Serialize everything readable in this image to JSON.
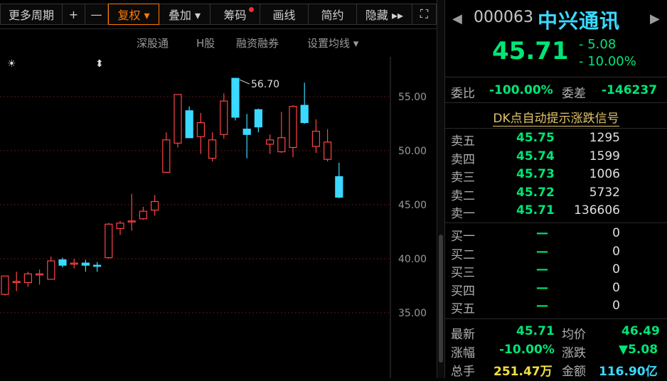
{
  "toolbar": {
    "items": [
      {
        "label": "更多周期",
        "w": 88
      },
      {
        "label": "+",
        "w": 32
      },
      {
        "label": "—",
        "w": 32
      },
      {
        "label": "复权 ▾",
        "w": 72,
        "active": true
      },
      {
        "label": "叠加 ▾",
        "w": 72
      },
      {
        "label": "筹码",
        "w": 70,
        "dot": true
      },
      {
        "label": "画线",
        "w": 68
      },
      {
        "label": "简约",
        "w": 68
      },
      {
        "label": "隐藏 ▸▸",
        "w": 78
      },
      {
        "label": "⛶",
        "w": 34
      }
    ]
  },
  "subbar": {
    "links": [
      "深股通",
      "H股",
      "融资融券",
      "设置均线 ▾"
    ]
  },
  "chart": {
    "markers": [
      "☀",
      "⬍"
    ],
    "y_labels": [
      "55.00",
      "50.00",
      "45.00",
      "40.00",
      "35.00"
    ],
    "high_annotation": "56.70",
    "up_color": "#ff4444",
    "down_color": "#3ad9ff"
  },
  "chart_data": {
    "type": "candlestick",
    "ylim": [
      33,
      59
    ],
    "candles": [
      {
        "o": 36.7,
        "h": 38.4,
        "l": 36.6,
        "c": 38.4
      },
      {
        "o": 37.9,
        "h": 38.8,
        "l": 37.0,
        "c": 37.9
      },
      {
        "o": 37.8,
        "h": 38.8,
        "l": 37.4,
        "c": 38.6
      },
      {
        "o": 38.5,
        "h": 39.0,
        "l": 37.6,
        "c": 38.6
      },
      {
        "o": 38.1,
        "h": 40.2,
        "l": 38.1,
        "c": 39.8
      },
      {
        "o": 39.9,
        "h": 40.1,
        "l": 39.2,
        "c": 39.4
      },
      {
        "o": 39.6,
        "h": 40.0,
        "l": 39.1,
        "c": 39.6
      },
      {
        "o": 39.6,
        "h": 39.9,
        "l": 38.8,
        "c": 39.4
      },
      {
        "o": 39.4,
        "h": 39.7,
        "l": 38.8,
        "c": 39.3
      },
      {
        "o": 40.1,
        "h": 43.3,
        "l": 40.0,
        "c": 43.2
      },
      {
        "o": 42.8,
        "h": 43.5,
        "l": 42.2,
        "c": 43.3
      },
      {
        "o": 43.4,
        "h": 46.0,
        "l": 42.6,
        "c": 43.5
      },
      {
        "o": 43.7,
        "h": 44.8,
        "l": 43.6,
        "c": 44.4
      },
      {
        "o": 44.5,
        "h": 45.9,
        "l": 44.0,
        "c": 45.3
      },
      {
        "o": 48.0,
        "h": 51.7,
        "l": 48.0,
        "c": 51.0
      },
      {
        "o": 50.7,
        "h": 55.2,
        "l": 50.3,
        "c": 55.2
      },
      {
        "o": 53.7,
        "h": 54.1,
        "l": 51.2,
        "c": 51.2
      },
      {
        "o": 51.3,
        "h": 53.5,
        "l": 49.7,
        "c": 52.6
      },
      {
        "o": 49.3,
        "h": 51.7,
        "l": 49.0,
        "c": 51.0
      },
      {
        "o": 51.5,
        "h": 55.3,
        "l": 51.1,
        "c": 54.6
      },
      {
        "o": 56.7,
        "h": 56.7,
        "l": 52.8,
        "c": 53.1
      },
      {
        "o": 52.0,
        "h": 53.4,
        "l": 49.3,
        "c": 51.5
      },
      {
        "o": 53.8,
        "h": 53.9,
        "l": 51.7,
        "c": 52.2
      },
      {
        "o": 50.6,
        "h": 51.5,
        "l": 49.7,
        "c": 51.0
      },
      {
        "o": 49.9,
        "h": 53.6,
        "l": 49.8,
        "c": 51.2
      },
      {
        "o": 50.3,
        "h": 54.2,
        "l": 49.4,
        "c": 54.1
      },
      {
        "o": 54.2,
        "h": 56.3,
        "l": 52.5,
        "c": 52.6
      },
      {
        "o": 50.4,
        "h": 52.9,
        "l": 49.8,
        "c": 51.8
      },
      {
        "o": 49.2,
        "h": 52.0,
        "l": 49.0,
        "c": 50.8
      },
      {
        "o": 47.6,
        "h": 48.9,
        "l": 45.6,
        "c": 45.7
      }
    ]
  },
  "quote": {
    "code": "000063",
    "name": "中兴通讯",
    "price": "45.71",
    "change": "- 5.08",
    "change_pct": "- 10.00%",
    "weibi_label": "委比",
    "weibi": "-100.00%",
    "weicha_label": "委差",
    "weicha": "-146237",
    "signal": "DK点自动提示涨跌信号"
  },
  "asks": [
    {
      "label": "卖五",
      "price": "45.75",
      "vol": "1295"
    },
    {
      "label": "卖四",
      "price": "45.74",
      "vol": "1599"
    },
    {
      "label": "卖三",
      "price": "45.73",
      "vol": "1006"
    },
    {
      "label": "卖二",
      "price": "45.72",
      "vol": "5732"
    },
    {
      "label": "卖一",
      "price": "45.71",
      "vol": "136606"
    }
  ],
  "bids": [
    {
      "label": "买一",
      "price": "—",
      "vol": "0"
    },
    {
      "label": "买二",
      "price": "—",
      "vol": "0"
    },
    {
      "label": "买三",
      "price": "—",
      "vol": "0"
    },
    {
      "label": "买四",
      "price": "—",
      "vol": "0"
    },
    {
      "label": "买五",
      "price": "—",
      "vol": "0"
    }
  ],
  "stats": {
    "zuixin_label": "最新",
    "zuixin": "45.71",
    "junjia_label": "均价",
    "junjia": "46.49",
    "zhangfu_label": "涨幅",
    "zhangfu": "-10.00%",
    "zhangdie_label": "涨跌",
    "zhangdie": "▼5.08",
    "zongshou_label": "总手",
    "zongshou": "251.47万",
    "jine_label": "金额",
    "jine": "116.90亿"
  }
}
